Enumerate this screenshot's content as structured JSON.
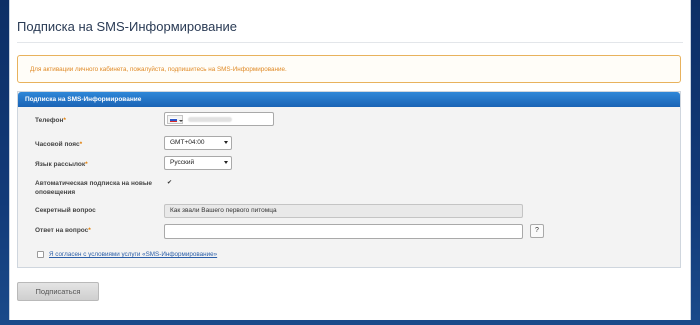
{
  "header": {
    "title": "Подписка на SMS-Информирование"
  },
  "alert": {
    "text": "Для активации личного кабинета, пожалуйста, подпишитесь на SMS-Информирование."
  },
  "panel": {
    "title": "Подписка на SMS-Информирование"
  },
  "form": {
    "phone": {
      "label": "Телефон",
      "required_mark": "*",
      "country_flag": "RU",
      "value_masked": true
    },
    "timezone": {
      "label": "Часовой пояс",
      "required_mark": "*",
      "value": "GMT+04:00"
    },
    "language": {
      "label": "Язык рассылок",
      "required_mark": "*",
      "value": "Русский"
    },
    "auto_subscribe": {
      "label_line1": "Автоматическая подписка на новые",
      "label_line2": "оповещения",
      "checked": true,
      "check_glyph": "✔"
    },
    "secret_question": {
      "label": "Секретный вопрос",
      "value": "Как звали Вашего первого питомца"
    },
    "secret_answer": {
      "label": "Ответ на вопрос",
      "required_mark": "*",
      "value": "",
      "help_glyph": "?"
    },
    "agreement": {
      "text": "Я согласен с условиями услуги «SMS-Информирование»",
      "checked": false
    }
  },
  "actions": {
    "submit_label": "Подписаться"
  },
  "colors": {
    "panel_header": "#1a63b5",
    "alert_border": "#e8b25d",
    "alert_text": "#e08a26",
    "required": "#e07b00",
    "link": "#2a5ea8"
  }
}
